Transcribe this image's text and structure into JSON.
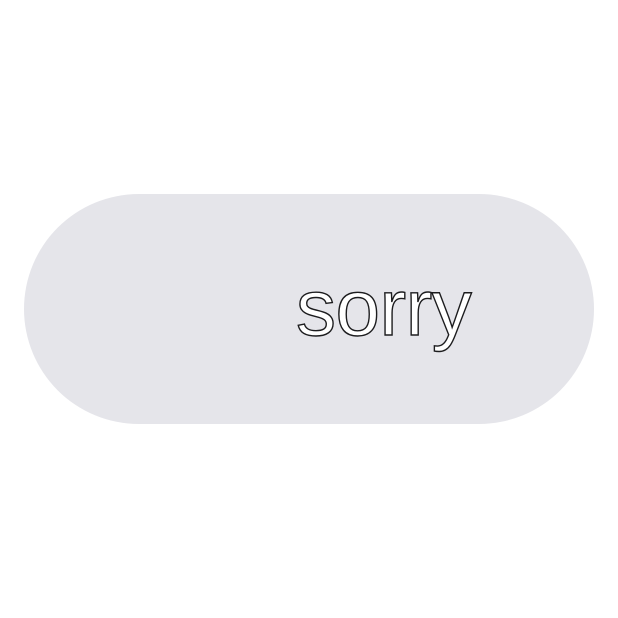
{
  "chip": {
    "label": "sorry"
  },
  "colors": {
    "background": "#ffffff",
    "chip_fill": "#e5e5ea",
    "text_fill": "#ffffff",
    "text_outline": "#1c1c1e"
  }
}
